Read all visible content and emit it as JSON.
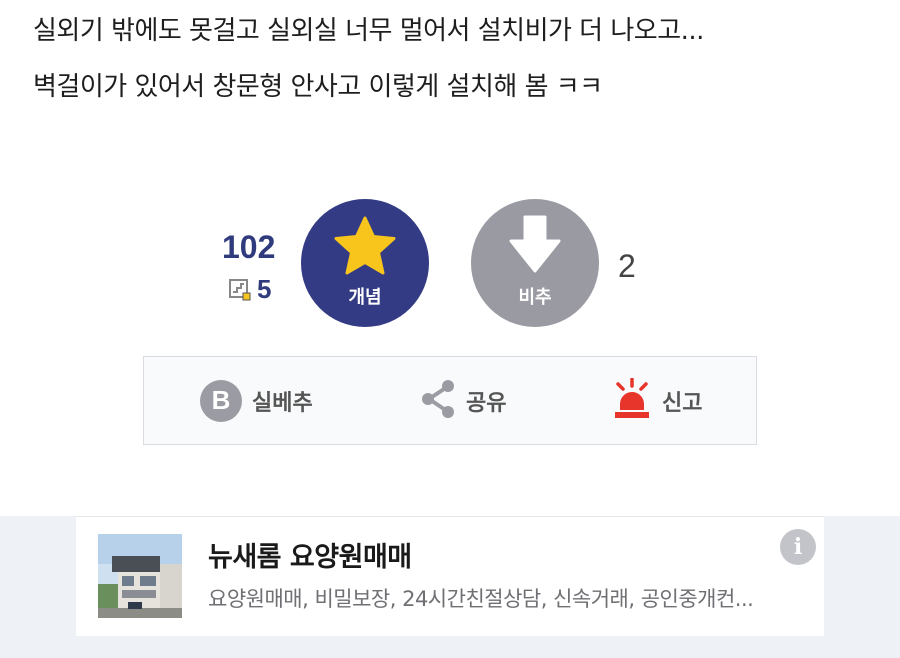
{
  "post": {
    "line1": "실외기 밖에도 못걸고 실외실 너무 멀어서 설치비가 더 나오고...",
    "line2": "벽걸이가 있어서 창문형 안사고 이렇게 설치해 봄 ㅋㅋ"
  },
  "vote": {
    "up_count": "102",
    "fix_count": "5",
    "up_label": "개념",
    "down_label": "비추",
    "down_count": "2",
    "up_icon": "star-icon",
    "down_icon": "arrow-down-icon",
    "fix_icon": "fixed-member-icon",
    "colors": {
      "up": "#333b85",
      "down": "#9a9aa2",
      "star": "#f7c51c",
      "report": "#e8352c"
    }
  },
  "actions": {
    "real_best_icon_letter": "B",
    "real_best_label": "실베추",
    "share_label": "공유",
    "report_label": "신고"
  },
  "ad": {
    "title": "뉴새롬 요양원매매",
    "description": "요양원매매, 비밀보장, 24시간친절상담, 신속거래, 공인중개컨...",
    "info_glyph": "i"
  }
}
